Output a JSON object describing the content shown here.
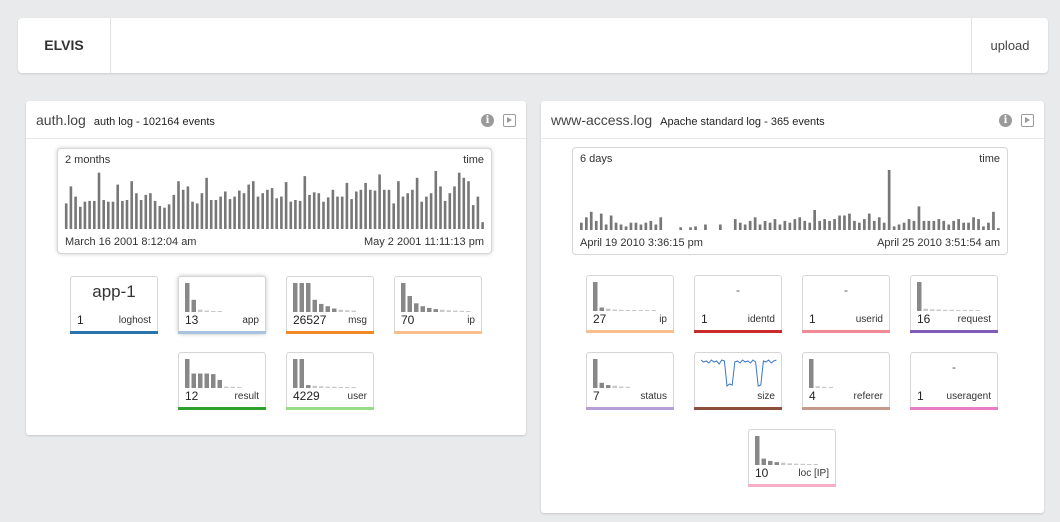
{
  "app": {
    "title": "ELVIS",
    "upload_label": "upload"
  },
  "panels": [
    {
      "name": "auth.log",
      "description": "auth log - 102164 events",
      "timeline": {
        "range_label": "2 months",
        "axis_label": "time",
        "start": "March 16 2001 8:12:04 am",
        "end": "May 2 2001 11:11:13 pm",
        "bars": [
          30,
          50,
          38,
          26,
          32,
          33,
          33,
          66,
          34,
          32,
          32,
          52,
          33,
          34,
          56,
          42,
          34,
          40,
          42,
          33,
          27,
          25,
          29,
          40,
          56,
          46,
          50,
          32,
          30,
          42,
          60,
          34,
          34,
          38,
          44,
          35,
          38,
          45,
          42,
          52,
          56,
          38,
          42,
          46,
          48,
          36,
          38,
          55,
          32,
          34,
          33,
          62,
          40,
          43,
          42,
          32,
          37,
          46,
          38,
          38,
          54,
          35,
          44,
          46,
          54,
          46,
          45,
          64,
          46,
          46,
          30,
          56,
          38,
          42,
          46,
          60,
          32,
          38,
          42,
          68,
          50,
          33,
          42,
          50,
          66,
          60,
          56,
          28,
          38,
          8
        ]
      },
      "fields": [
        {
          "name": "loghost",
          "count": "1",
          "headline": "app-1",
          "color": "#2a74ad",
          "bars": []
        },
        {
          "name": "app",
          "count": "13",
          "color": "#a8c3e0",
          "selected": true,
          "bars": [
            1.0,
            0.42,
            0.08,
            0.05,
            0.03,
            0.02
          ]
        },
        {
          "name": "msg",
          "count": "26527",
          "color": "#f08a28",
          "bars": [
            1.0,
            1.0,
            1.0,
            0.42,
            0.28,
            0.2,
            0.12,
            0.08,
            0.06,
            0.05
          ]
        },
        {
          "name": "ip",
          "count": "70",
          "color": "#f8be8c",
          "bars": [
            1.0,
            0.55,
            0.3,
            0.2,
            0.14,
            0.1,
            0.08,
            0.06,
            0.05,
            0.04,
            0.03
          ]
        },
        {
          "name": "result",
          "count": "12",
          "color": "#2fa02f",
          "bars": [
            1.0,
            0.5,
            0.5,
            0.5,
            0.48,
            0.28,
            0.05,
            0.04,
            0.03
          ]
        },
        {
          "name": "user",
          "count": "4229",
          "color": "#98db88",
          "bars": [
            1.0,
            1.0,
            0.1,
            0.08,
            0.06,
            0.05,
            0.04,
            0.03,
            0.03,
            0.02
          ]
        }
      ]
    },
    {
      "name": "www-access.log",
      "description": "Apache standard log - 365 events",
      "timeline": {
        "range_label": "6 days",
        "axis_label": "time",
        "start": "April 19 2010 3:36:15 pm",
        "end": "April 25 2010 3:51:54 am",
        "bars": [
          8,
          14,
          20,
          10,
          18,
          6,
          16,
          8,
          6,
          4,
          8,
          8,
          6,
          8,
          10,
          6,
          14,
          0,
          0,
          0,
          3,
          0,
          3,
          4,
          0,
          6,
          0,
          0,
          6,
          0,
          0,
          12,
          8,
          6,
          10,
          14,
          6,
          10,
          8,
          12,
          6,
          10,
          8,
          12,
          14,
          10,
          8,
          22,
          10,
          12,
          10,
          12,
          16,
          16,
          18,
          10,
          8,
          12,
          18,
          10,
          14,
          8,
          66,
          4,
          6,
          8,
          12,
          10,
          26,
          10,
          10,
          10,
          12,
          10,
          6,
          10,
          12,
          8,
          8,
          14,
          12,
          4,
          8,
          20,
          2
        ]
      },
      "fields": [
        {
          "name": "ip",
          "count": "27",
          "color": "#f8be8c",
          "bars": [
            1.0,
            0.12,
            0.08,
            0.05,
            0.04,
            0.03,
            0.03,
            0.02,
            0.02,
            0.02
          ]
        },
        {
          "name": "identd",
          "count": "1",
          "headline": "-",
          "color": "#c92a2a",
          "bars": []
        },
        {
          "name": "userid",
          "count": "1",
          "headline": "-",
          "color": "#f28a96",
          "bars": []
        },
        {
          "name": "request",
          "count": "16",
          "color": "#7e5bb5",
          "bars": [
            1.0,
            0.08,
            0.06,
            0.05,
            0.04,
            0.04,
            0.03,
            0.03,
            0.03,
            0.02
          ]
        },
        {
          "name": "status",
          "count": "7",
          "color": "#b79ed6",
          "bars": [
            1.0,
            0.18,
            0.1,
            0.08,
            0.05,
            0.04
          ]
        },
        {
          "name": "size",
          "count": "",
          "color": "#8c4f3c",
          "line": true,
          "bars": []
        },
        {
          "name": "referer",
          "count": "4",
          "color": "#c59a8d",
          "bars": [
            1.0,
            0.06,
            0.04,
            0.03
          ]
        },
        {
          "name": "useragent",
          "count": "1",
          "headline": "-",
          "color": "#e67dc6",
          "bars": []
        },
        {
          "name": "loc [IP]",
          "count": "10",
          "color": "#f5b0c8",
          "bars": [
            1.0,
            0.22,
            0.14,
            0.1,
            0.08,
            0.06,
            0.05,
            0.04,
            0.03,
            0.02
          ]
        }
      ]
    }
  ]
}
